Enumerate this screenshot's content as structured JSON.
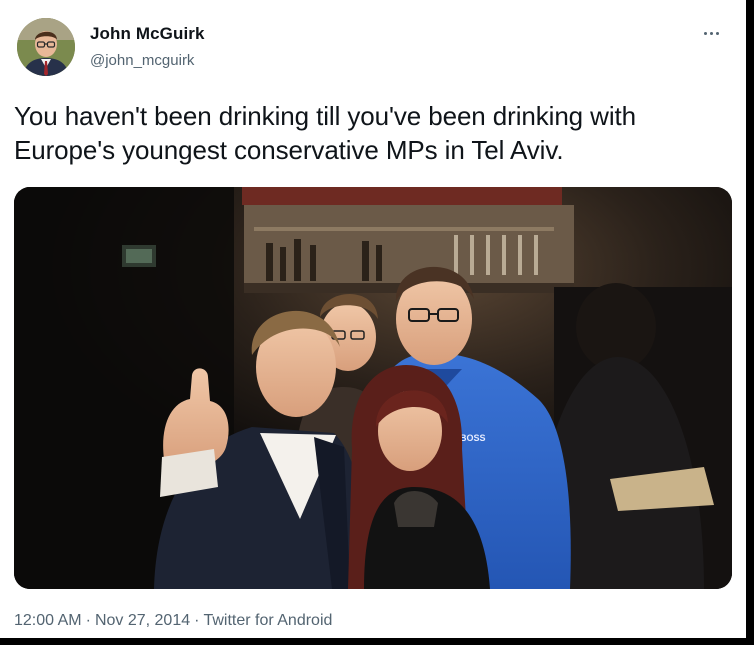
{
  "author": {
    "display_name": "John McGuirk",
    "handle": "@john_mcguirk"
  },
  "tweet": {
    "text": "You haven't been drinking till you've been drinking with Europe's youngest conservative MPs in Tel Aviv."
  },
  "photo": {
    "shirt_logo": "BOSS"
  },
  "meta": {
    "time": "12:00 AM",
    "separator": "·",
    "date": "Nov 27, 2014",
    "source": "Twitter for Android"
  },
  "icons": {
    "more": "more-icon"
  },
  "colors": {
    "text_primary": "#0f1419",
    "text_secondary": "#536471",
    "background": "#ffffff"
  }
}
